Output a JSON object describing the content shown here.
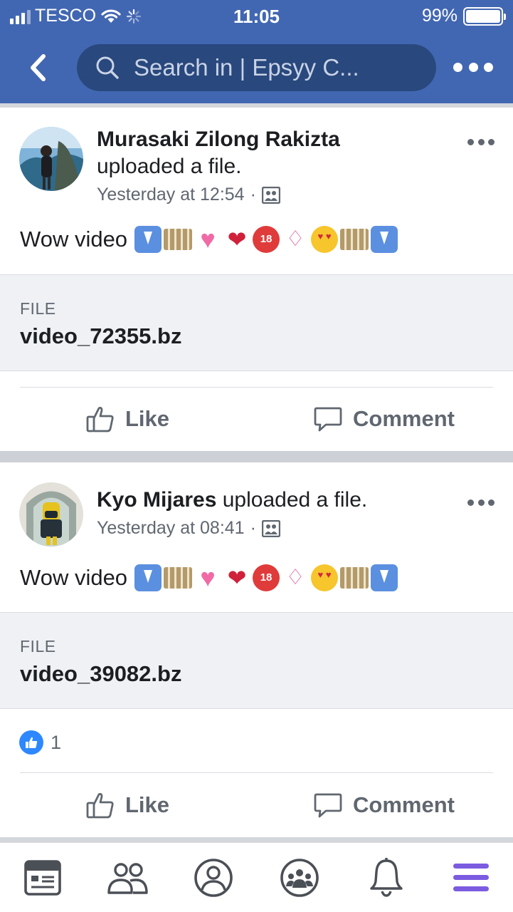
{
  "status_bar": {
    "carrier": "TESCO",
    "time": "11:05",
    "battery": "99%",
    "battery_level": 0.99
  },
  "header": {
    "search_placeholder": "Search in | Epsyy C...",
    "icons": [
      "back-icon",
      "search-icon",
      "more-icon"
    ],
    "color": "#4267b2"
  },
  "posts": [
    {
      "author": "Murasaki Zilong Rakizta",
      "action": "uploaded a file.",
      "time": "Yesterday at 12:54",
      "separator": "·",
      "privacy_icon": "group-icon",
      "text": "Wow video",
      "emoji_names": [
        "down-arrow-icon",
        "film-icon",
        "sparkling-heart-icon",
        "kiss-mark-icon",
        "no-under-18-icon",
        "bikini-icon",
        "heart-eyes-icon",
        "film-icon",
        "down-arrow-icon"
      ],
      "file_label": "FILE",
      "file_name": "video_72355.bz",
      "reactions": null,
      "like_label": "Like",
      "comment_label": "Comment"
    },
    {
      "author": "Kyo Mijares",
      "action": "uploaded a file.",
      "time": "Yesterday at 08:41",
      "separator": "·",
      "privacy_icon": "group-icon",
      "text": "Wow video",
      "emoji_names": [
        "down-arrow-icon",
        "film-icon",
        "sparkling-heart-icon",
        "kiss-mark-icon",
        "no-under-18-icon",
        "bikini-icon",
        "heart-eyes-icon",
        "film-icon",
        "down-arrow-icon"
      ],
      "file_label": "FILE",
      "file_name": "video_39082.bz",
      "reactions": {
        "count": "1"
      },
      "like_label": "Like",
      "comment_label": "Comment"
    }
  ],
  "tab_bar": {
    "tabs": [
      "news-feed-icon",
      "friends-icon",
      "profile-icon",
      "groups-icon",
      "notifications-icon",
      "menu-icon"
    ],
    "active": "menu-icon",
    "active_color": "#7b5ce0"
  }
}
